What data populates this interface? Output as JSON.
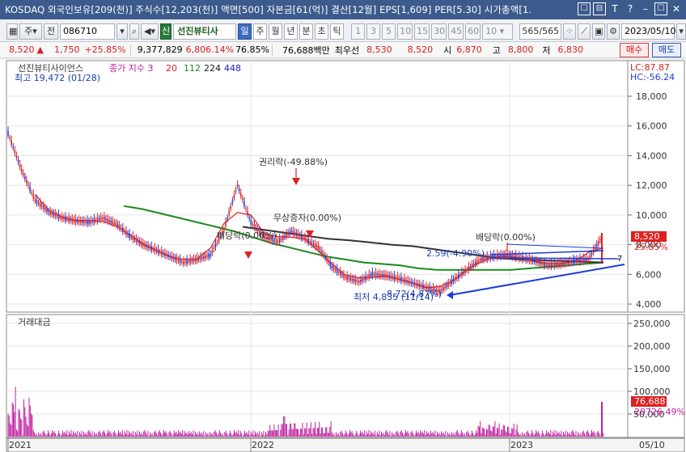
{
  "titlebar": {
    "text": "KOSDAQ 외국인보유[209(천)] 주식수[12,203(천)] 액면[500] 자본금[61(억)] 결산[12월] EPS[1,609] PER[5.30] 시가총액[1.",
    "buttons": [
      "☐",
      "⊟",
      "T",
      "?",
      "–",
      "☐",
      "✕"
    ]
  },
  "toolbar": {
    "menu_label": "주",
    "jeon_label": "전",
    "code": "086710",
    "stock_badge": "신",
    "stock_name": "선진뷰티사",
    "periods": [
      "일",
      "주",
      "월",
      "년",
      "분",
      "초",
      "틱"
    ],
    "selected_period": "일",
    "intervals": [
      "1",
      "3",
      "5",
      "10",
      "15",
      "30",
      "45",
      "60"
    ],
    "interval_value": "10",
    "count_value": "565",
    "count_total": "/565",
    "date": "2023/05/10"
  },
  "price_row": {
    "price": "8,520",
    "arrow": "▲",
    "change": "1,750",
    "change_pct": "+25.85%",
    "volume": "9,377,829",
    "vol_ratio": "6,806.14%",
    "ratio2": "76.85%",
    "amount": "76,688백만",
    "best_sell_label": "최우선",
    "best_sell": "8,530",
    "best_buy": "8,520",
    "open_label": "시",
    "open": "6,870",
    "high_label": "고",
    "high": "8,800",
    "low_label": "저",
    "low": "6,830",
    "buy_label": "매수",
    "sell_label": "매도"
  },
  "chart": {
    "legend": {
      "name": "선진뷰티사이언스",
      "title": "종가 지수 3",
      "ma": [
        "20",
        "112",
        "224",
        "448"
      ],
      "ma_colors": [
        "#e02020",
        "#1a8a1a",
        "#1a1a1a",
        "#2020c0"
      ]
    },
    "max_label": "최고 19,472 (01/28)",
    "min_label": "최저 4,835 (11/14)",
    "lc": "LC:87.87",
    "hc": "HC:-56.24",
    "price_axis": [
      "18,000",
      "16,000",
      "14,000",
      "12,000",
      "10,000",
      "8,000",
      "6,000",
      "4,000"
    ],
    "current_price_tag": "8,520",
    "current_pct_tag": "25.85%",
    "trend_end_label": "7",
    "annotations": [
      {
        "text": "권리락(-49.88%)"
      },
      {
        "text": "무상증자(0.00%)"
      },
      {
        "text": "배당락(0.00%)"
      },
      {
        "text": "배당락(0.00%)"
      },
      {
        "text": "2.59(-4.90%)"
      },
      {
        "text": "8,72(4,87%)"
      }
    ],
    "volume_title": "거래대금",
    "volume_axis": [
      "250,000",
      "200,000",
      "150,000",
      "100,000",
      "50,000"
    ],
    "volume_tag": "76,688",
    "volume_tag2": "20726.49%",
    "x_labels": [
      "2021",
      "2022",
      "2023",
      "05/10"
    ]
  },
  "chart_data": {
    "type": "line",
    "title": "선진뷰티사이언스",
    "xlabel": "",
    "ylabel": "",
    "ylim": [
      3500,
      19500
    ],
    "x_labels": [
      "2021",
      "2022",
      "2023"
    ],
    "series": [
      {
        "name": "종가",
        "values": [
          15500,
          13000,
          11000,
          10200,
          9800,
          9600,
          9500,
          9800,
          9400,
          8600,
          8000,
          7600,
          7200,
          6800,
          7000,
          7300,
          9000,
          12000,
          9500,
          8500,
          8200,
          8900,
          8400,
          7800,
          6500,
          5800,
          5500,
          6000,
          5900,
          5700,
          5400,
          5100,
          4835,
          5600,
          6300,
          7000,
          7200,
          7300,
          7100,
          6900,
          6600,
          6700,
          6900,
          7000,
          8520
        ]
      },
      {
        "name": "112",
        "values": [
          10600,
          10400,
          10100,
          9800,
          9500,
          9200,
          8900,
          8500,
          8100,
          7800,
          7500,
          7200,
          7000,
          6800,
          6700,
          6600,
          6400,
          6300,
          6300,
          6300,
          6300,
          6300,
          6400,
          6500,
          6600,
          6700,
          6800
        ]
      },
      {
        "name": "224",
        "values": [
          9200,
          9000,
          8800,
          8600,
          8400,
          8300,
          8150,
          8000,
          7900,
          7700,
          7500,
          7300,
          7100,
          7000,
          6950,
          6900,
          6850,
          6800
        ]
      }
    ]
  }
}
